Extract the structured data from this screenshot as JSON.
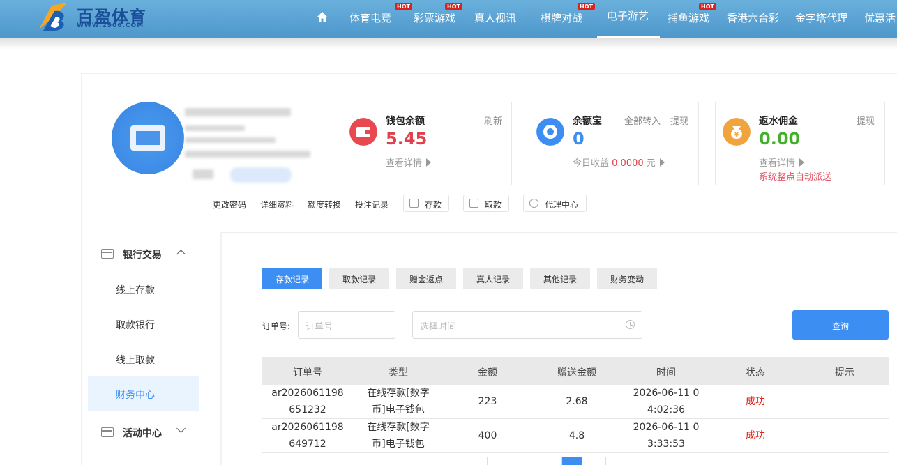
{
  "header": {
    "logo_text": "百盈体育",
    "logo_url": "WWW.2906.COM",
    "hot_badge": "HOT",
    "nav": [
      {
        "label": "体育电竞",
        "hot": true
      },
      {
        "label": "彩票游戏",
        "hot": true
      },
      {
        "label": "真人视讯",
        "hot": false
      },
      {
        "label": "棋牌对战",
        "hot": true
      },
      {
        "label": "电子游艺",
        "hot": false,
        "active": true
      },
      {
        "label": "捕鱼游戏",
        "hot": true
      },
      {
        "label": "香港六合彩",
        "hot": false
      },
      {
        "label": "金字塔代理",
        "hot": false
      },
      {
        "label": "优惠活",
        "hot": false
      }
    ]
  },
  "wallets": {
    "main": {
      "title": "钱包余额",
      "value": "5.45",
      "action": "刷新",
      "link": "查看详情"
    },
    "yuebao": {
      "title": "余额宝",
      "value": "0",
      "action1": "全部转入",
      "action2": "提现",
      "earn_label": "今日收益",
      "earn_value": "0.0000",
      "earn_unit": "元"
    },
    "rebate": {
      "title": "返水佣金",
      "value": "0.00",
      "action": "提现",
      "link": "查看详情",
      "note": "系统整点自动派送"
    }
  },
  "actions": {
    "change_password": "更改密码",
    "details": "详细资料",
    "transfer": "额度转换",
    "bet_records": "投注记录",
    "deposit": "存款",
    "withdraw": "取款",
    "agent": "代理中心"
  },
  "sidebar": {
    "group1": "银行交易",
    "items": [
      "线上存款",
      "取款银行",
      "线上取款",
      "财务中心"
    ],
    "group2": "活动中心"
  },
  "tabs": [
    "存款记录",
    "取款记录",
    "赠金返点",
    "真人记录",
    "其他记录",
    "财务变动"
  ],
  "filter": {
    "order_label": "订单号:",
    "order_placeholder": "订单号",
    "time_placeholder": "选择时间",
    "query": "查询"
  },
  "table": {
    "columns": [
      "订单号",
      "类型",
      "金额",
      "赠送金额",
      "时间",
      "状态",
      "提示"
    ],
    "rows": [
      {
        "order_1": "ar2026061198",
        "order_2": "651232",
        "type_1": "在线存款[数字",
        "type_2": "币]电子钱包",
        "amount": "223",
        "bonus": "2.68",
        "time_1": "2026-06-11 0",
        "time_2": "4:02:36",
        "status": "成功",
        "tip": ""
      },
      {
        "order_1": "ar2026061198",
        "order_2": "649712",
        "type_1": "在线存款[数字",
        "type_2": "币]电子钱包",
        "amount": "400",
        "bonus": "4.8",
        "time_1": "2026-06-11 0",
        "time_2": "3:33:53",
        "status": "成功",
        "tip": ""
      }
    ]
  },
  "colors": {
    "header_blue": "#5aa3d6",
    "primary": "#3d8ef3",
    "balance_red": "#e0404e",
    "yuebao_blue": "#3d8ef3",
    "rebate_green": "#43b02a",
    "success_red": "#d9231c"
  },
  "icons": {
    "home": "home-icon",
    "wallet": "wallet-icon",
    "yuebao": "yuebao-icon",
    "rebate": "money-bag-icon",
    "clock": "clock-icon"
  }
}
